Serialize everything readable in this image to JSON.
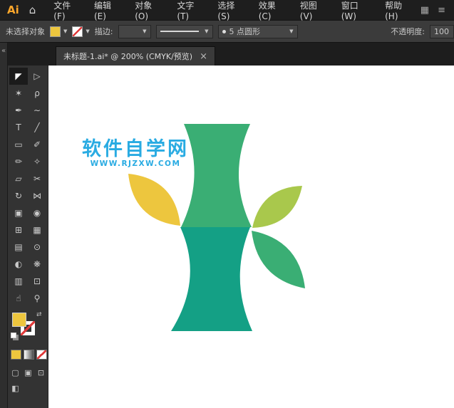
{
  "menu_bar": {
    "logo": "Ai",
    "home_glyph": "⌂",
    "items": [
      {
        "name": "file",
        "label": "文件(F)"
      },
      {
        "name": "edit",
        "label": "编辑(E)"
      },
      {
        "name": "object",
        "label": "对象(O)"
      },
      {
        "name": "type",
        "label": "文字(T)"
      },
      {
        "name": "select",
        "label": "选择(S)"
      },
      {
        "name": "effect",
        "label": "效果(C)"
      },
      {
        "name": "view",
        "label": "视图(V)"
      },
      {
        "name": "window",
        "label": "窗口(W)"
      },
      {
        "name": "help",
        "label": "帮助(H)"
      }
    ],
    "right_icons": [
      {
        "name": "arrange-documents",
        "glyph": "▦"
      },
      {
        "name": "app-menu",
        "glyph": "≡"
      }
    ]
  },
  "control_bar": {
    "selection_status": "未选择对象",
    "stroke_label": "描边:",
    "brush_name": "5 点圆形",
    "opacity_label": "不透明度:",
    "opacity_value": "100",
    "fill_color": "#edc63e",
    "dropdown_arrow": "▼"
  },
  "dock": {
    "collapse_glyph": "«"
  },
  "tab_bar": {
    "tab_title": "未标题-1.ai* @ 200% (CMYK/预览)",
    "close_glyph": "×"
  },
  "toolbar": {
    "fill_color": "#edc63e",
    "swap_glyph": "⇄",
    "tools": [
      {
        "name": "selection",
        "glyph": "◤",
        "selected": true
      },
      {
        "name": "direct-selection",
        "glyph": "▷"
      },
      {
        "name": "magic-wand",
        "glyph": "✶"
      },
      {
        "name": "lasso",
        "glyph": "ρ"
      },
      {
        "name": "pen",
        "glyph": "✒"
      },
      {
        "name": "curvature",
        "glyph": "∼"
      },
      {
        "name": "type",
        "glyph": "T"
      },
      {
        "name": "line-segment",
        "glyph": "╱"
      },
      {
        "name": "rectangle",
        "glyph": "▭"
      },
      {
        "name": "paintbrush",
        "glyph": "✐"
      },
      {
        "name": "pencil",
        "glyph": "✏"
      },
      {
        "name": "shaper",
        "glyph": "✧"
      },
      {
        "name": "eraser",
        "glyph": "▱"
      },
      {
        "name": "scissors",
        "glyph": "✂"
      },
      {
        "name": "rotate",
        "glyph": "↻"
      },
      {
        "name": "width",
        "glyph": "⋈"
      },
      {
        "name": "free-transform",
        "glyph": "▣"
      },
      {
        "name": "shape-builder",
        "glyph": "◉"
      },
      {
        "name": "perspective-grid",
        "glyph": "⊞"
      },
      {
        "name": "mesh",
        "glyph": "▦"
      },
      {
        "name": "gradient",
        "glyph": "▤"
      },
      {
        "name": "eyedropper",
        "glyph": "⊙"
      },
      {
        "name": "blend",
        "glyph": "◐"
      },
      {
        "name": "symbol-sprayer",
        "glyph": "❋"
      },
      {
        "name": "column-graph",
        "glyph": "▥"
      },
      {
        "name": "artboard",
        "glyph": "⊡"
      },
      {
        "name": "hand",
        "glyph": "☝"
      },
      {
        "name": "zoom",
        "glyph": "⚲"
      }
    ],
    "draw_modes": [
      {
        "name": "draw-normal",
        "glyph": "▢"
      },
      {
        "name": "draw-behind",
        "glyph": "▣"
      },
      {
        "name": "draw-inside",
        "glyph": "⊡"
      }
    ],
    "screen_mode_glyph": "◧"
  },
  "canvas": {
    "watermark": {
      "line1": "软件自学网",
      "line2": "WWW.RJZXW.COM",
      "color": "#29abe2"
    },
    "artwork": {
      "colors": {
        "segment_top": "#3aae74",
        "segment_bottom": "#14a085",
        "leaf_yellow": "#edc63e",
        "leaf_light_green": "#a9c84c",
        "leaf_green": "#3aae74"
      }
    }
  }
}
